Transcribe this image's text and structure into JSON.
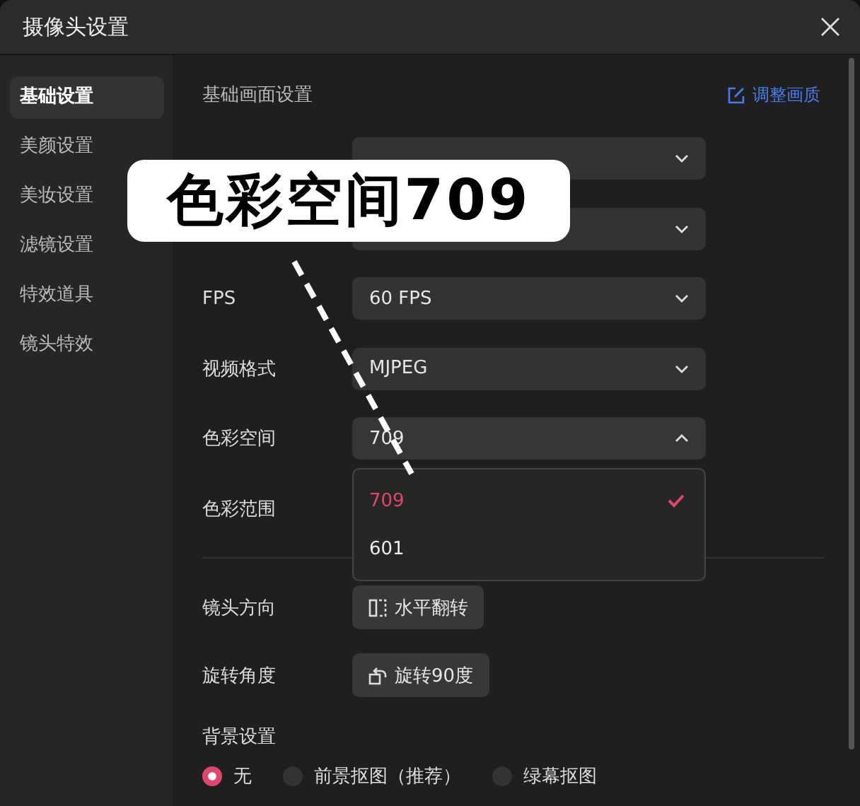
{
  "window": {
    "title": "摄像头设置"
  },
  "sidebar": {
    "items": [
      {
        "label": "基础设置",
        "selected": true
      },
      {
        "label": "美颜设置",
        "selected": false
      },
      {
        "label": "美妆设置",
        "selected": false
      },
      {
        "label": "滤镜设置",
        "selected": false
      },
      {
        "label": "特效道具",
        "selected": false
      },
      {
        "label": "镜头特效",
        "selected": false
      }
    ]
  },
  "section": {
    "title": "基础画面设置",
    "action": "调整画质"
  },
  "fields": [
    {
      "kind": "select",
      "open": false
    },
    {
      "kind": "select",
      "open": false
    },
    {
      "label": "FPS",
      "kind": "select",
      "value": "60 FPS",
      "open": false
    },
    {
      "label": "视频格式",
      "kind": "select",
      "value": "MJPEG",
      "open": false
    },
    {
      "label": "色彩空间",
      "kind": "select",
      "value": "709",
      "open": true,
      "options": [
        {
          "label": "709",
          "selected": true
        },
        {
          "label": "601",
          "selected": false
        }
      ]
    },
    {
      "label": "色彩范围",
      "kind": "select",
      "open": false
    }
  ],
  "actions": [
    {
      "label": "镜头方向",
      "button": "水平翻转"
    },
    {
      "label": "旋转角度",
      "button": "旋转90度"
    }
  ],
  "background": {
    "label": "背景设置",
    "options": [
      {
        "label": "无",
        "selected": true
      },
      {
        "label": "前景抠图（推荐）",
        "selected": false
      },
      {
        "label": "绿幕抠图",
        "selected": false
      }
    ]
  },
  "callout": {
    "text": "色彩空间709"
  }
}
